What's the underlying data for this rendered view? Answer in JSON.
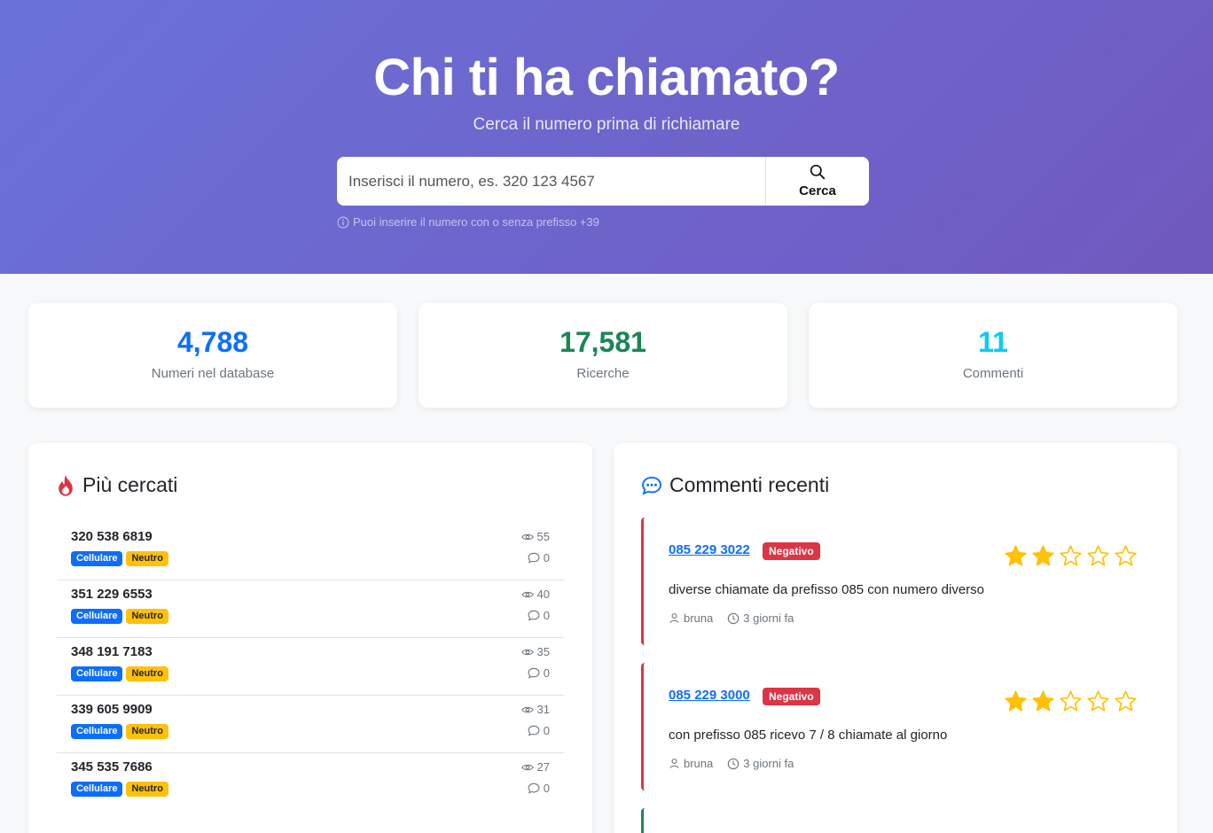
{
  "hero": {
    "title": "Chi ti ha chiamato?",
    "subtitle": "Cerca il numero prima di richiamare",
    "search_placeholder": "Inserisci il numero, es. 320 123 4567",
    "search_button": "Cerca",
    "hint": "Puoi inserire il numero con o senza prefisso +39"
  },
  "stats": [
    {
      "value": "4,788",
      "label": "Numeri nel database",
      "color": "#0d6efd"
    },
    {
      "value": "17,581",
      "label": "Ricerche",
      "color": "#198754"
    },
    {
      "value": "11",
      "label": "Commenti",
      "color": "#0dcaf0"
    }
  ],
  "popular": {
    "title": "Più cercati",
    "items": [
      {
        "number": "320 538 6819",
        "type": "Cellulare",
        "rating": "Neutro",
        "views": "55",
        "comments": "0"
      },
      {
        "number": "351 229 6553",
        "type": "Cellulare",
        "rating": "Neutro",
        "views": "40",
        "comments": "0"
      },
      {
        "number": "348 191 7183",
        "type": "Cellulare",
        "rating": "Neutro",
        "views": "35",
        "comments": "0"
      },
      {
        "number": "339 605 9909",
        "type": "Cellulare",
        "rating": "Neutro",
        "views": "31",
        "comments": "0"
      },
      {
        "number": "345 535 7686",
        "type": "Cellulare",
        "rating": "Neutro",
        "views": "27",
        "comments": "0"
      }
    ]
  },
  "recent": {
    "title": "Commenti recenti",
    "items": [
      {
        "number": "085 229 3022",
        "badge": "Negativo",
        "stars": 2,
        "max_stars": 5,
        "text": "diverse chiamate da prefisso 085 con numero diverso",
        "user": "bruna",
        "time": "3 giorni fa"
      },
      {
        "number": "085 229 3000",
        "badge": "Negativo",
        "stars": 2,
        "max_stars": 5,
        "text": "con prefisso 085 ricevo 7 / 8 chiamate al giorno",
        "user": "bruna",
        "time": "3 giorni fa"
      }
    ]
  },
  "colors": {
    "accent_red": "#dc3545",
    "accent_green": "#198754",
    "star": "#ffc107",
    "link": "#0d6efd"
  }
}
